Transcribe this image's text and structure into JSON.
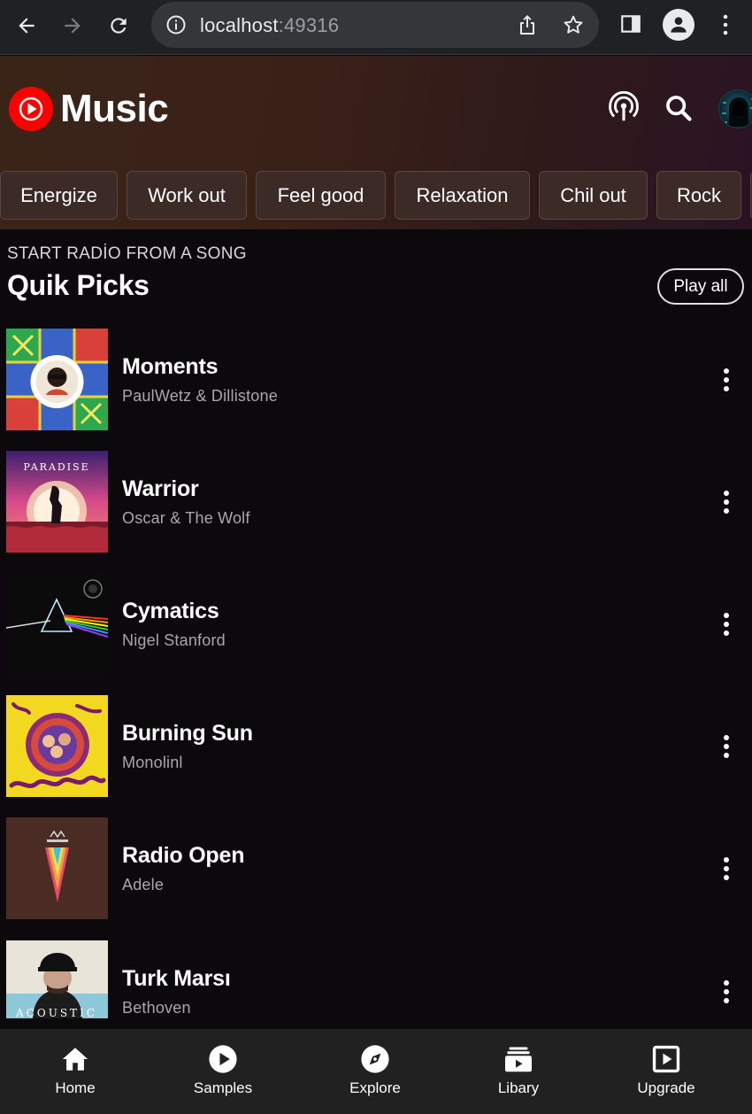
{
  "browser": {
    "url_host": "localhost",
    "url_port": ":49316"
  },
  "header": {
    "logo_text": "Music",
    "icons": [
      "cast-icon",
      "search-icon",
      "avatar"
    ]
  },
  "chips": [
    "Energize",
    "Work out",
    "Feel good",
    "Relaxation",
    "Chil out",
    "Rock"
  ],
  "section": {
    "subtitle": "START RADİO FROM A SONG",
    "title": "Quik Picks",
    "play_all": "Play all"
  },
  "songs": [
    {
      "title": "Moments",
      "artist": "PaulWetz & Dillistone"
    },
    {
      "title": "Warrior",
      "artist": "Oscar & The Wolf"
    },
    {
      "title": "Cymatics",
      "artist": "Nigel Stanford"
    },
    {
      "title": "Burning Sun",
      "artist": "Monolinl"
    },
    {
      "title": "Radio Open",
      "artist": "Adele"
    },
    {
      "title": "Turk Marsı",
      "artist": "Bethoven"
    }
  ],
  "album_art_text": {
    "warrior": "PARADISE",
    "turk": "ACOUSTIC"
  },
  "nav": [
    {
      "label": "Home",
      "icon": "home-icon"
    },
    {
      "label": "Samples",
      "icon": "play-circle-icon"
    },
    {
      "label": "Explore",
      "icon": "compass-icon"
    },
    {
      "label": "Libary",
      "icon": "library-icon"
    },
    {
      "label": "Upgrade",
      "icon": "upgrade-icon"
    }
  ],
  "colors": {
    "brand_red": "#ff0000",
    "background": "#0b090c",
    "chip_bg": "#3b2a26",
    "nav_bg": "#212121"
  }
}
